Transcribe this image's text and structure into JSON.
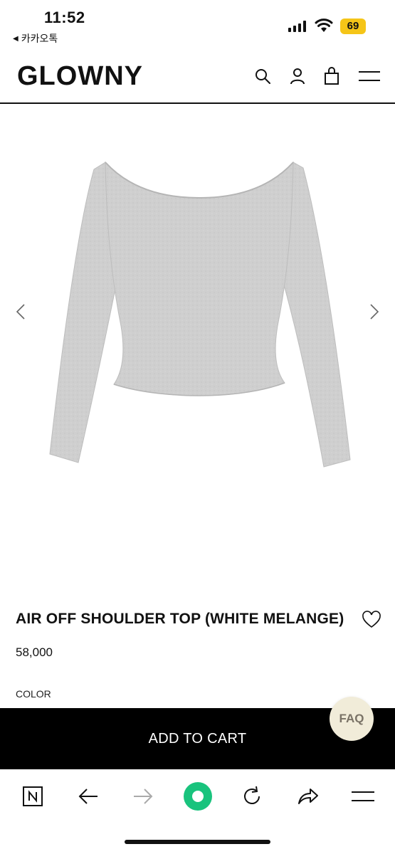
{
  "status_bar": {
    "time": "11:52",
    "back_app": "카카오톡",
    "battery": "69",
    "battery_color": "#f5c518"
  },
  "header": {
    "logo": "GLOWNY",
    "icons": [
      "search-icon",
      "user-icon",
      "bag-icon",
      "menu-icon"
    ]
  },
  "gallery": {
    "image_alt": "gray off shoulder long sleeve top",
    "prev_icon": "chevron-left-icon",
    "next_icon": "chevron-right-icon"
  },
  "product": {
    "title": "AIR OFF SHOULDER TOP (WHITE MELANGE)",
    "price": "58,000",
    "color_label": "COLOR"
  },
  "faq_label": "FAQ",
  "cart_button": "ADD TO CART",
  "colors": {
    "accent": "#000000",
    "faq_bg": "#f1ecd9",
    "browser_green": "#19c37d"
  },
  "browser_toolbar": {
    "icons": [
      "naver-icon",
      "back-arrow-icon",
      "forward-arrow-icon",
      "green-dot-icon",
      "refresh-icon",
      "share-icon",
      "menu-icon"
    ]
  }
}
